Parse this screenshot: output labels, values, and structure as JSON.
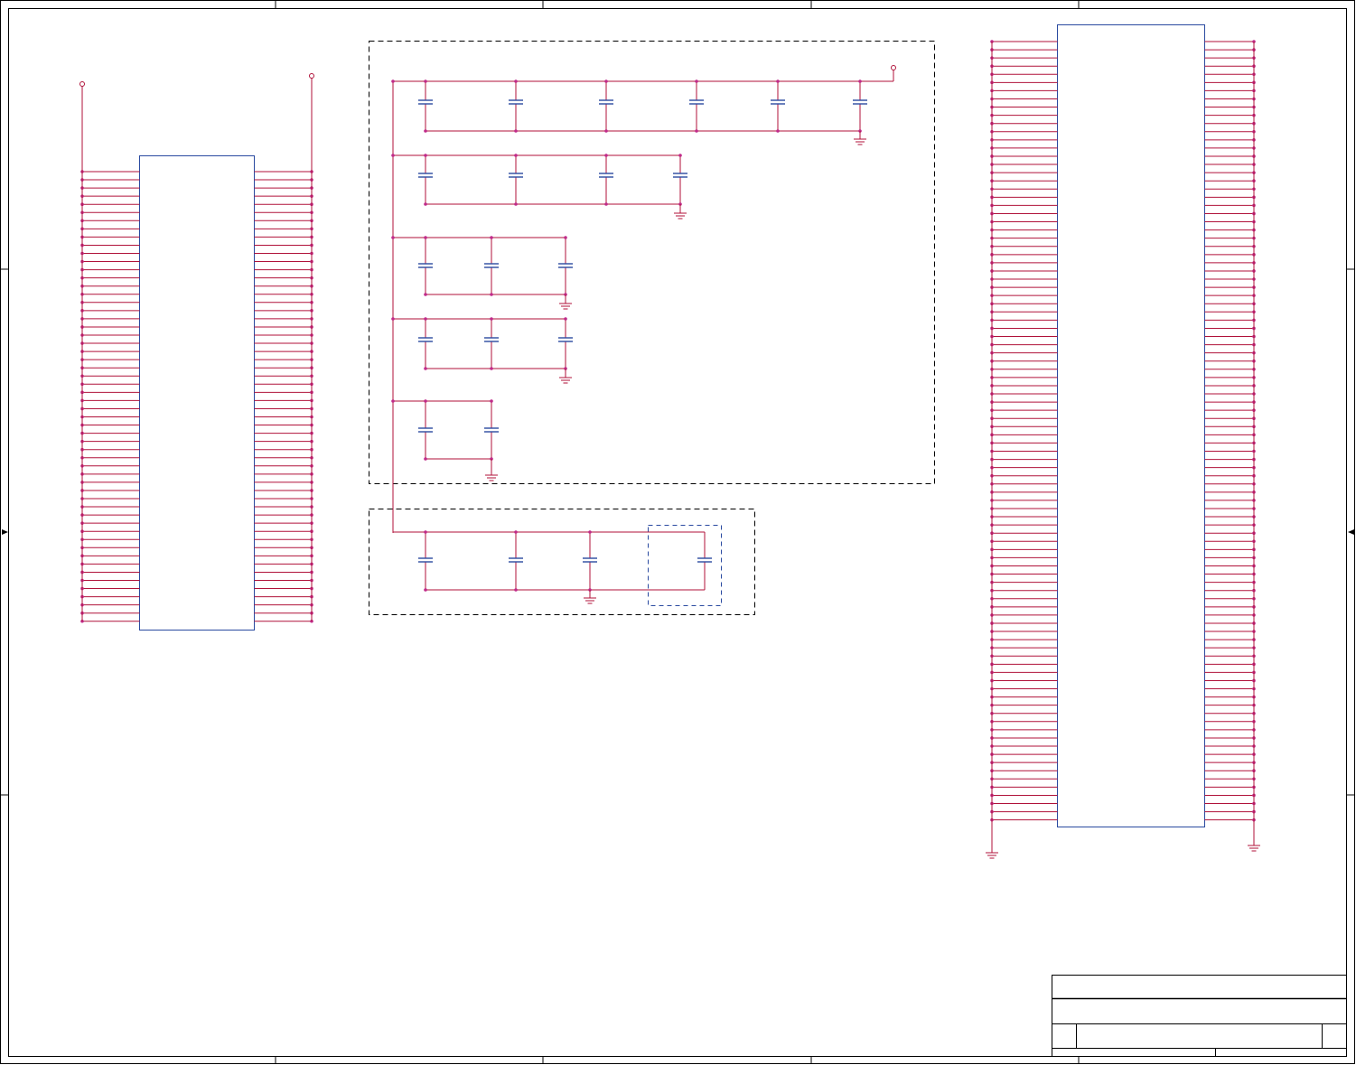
{
  "sheet": {
    "title_block": {
      "title": "",
      "size": "",
      "document_number": "",
      "revision": "",
      "date": "",
      "sheet_of": ""
    }
  },
  "colors": {
    "wire": "#b0123a",
    "component_body": "#2a4aa0",
    "net_node": "#c02a8a",
    "frame": "#000000",
    "dashed_group": "#000000",
    "dashed_group_blue": "#2a4aa0"
  },
  "connectors": {
    "left_header": {
      "pins_per_side": 56
    },
    "right_header": {
      "left_pins": 96,
      "right_pins": 96
    }
  },
  "decoupling": {
    "rows": [
      {
        "capacitors": 6
      },
      {
        "capacitors": 4
      },
      {
        "capacitors": 3
      },
      {
        "capacitors": 3
      },
      {
        "capacitors": 2
      }
    ],
    "bulk_group": {
      "capacitors": 4,
      "optional_capacitors": 1
    }
  },
  "symbols": [
    "ground-symbol",
    "power-port-symbol",
    "capacitor-symbol",
    "net-node"
  ]
}
